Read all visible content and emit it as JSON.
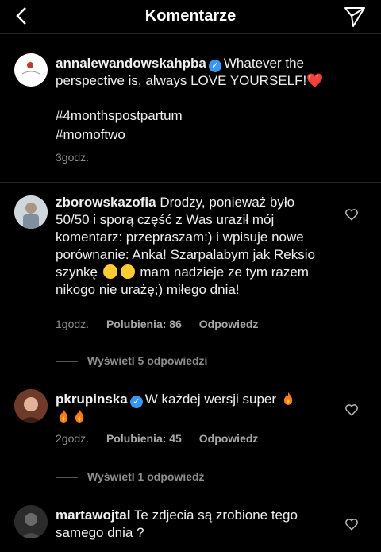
{
  "header": {
    "title": "Komentarze"
  },
  "caption": {
    "username": "annalewandowskahpba",
    "text": "Whatever the perspective is, always LOVE YOURSELF!❤️",
    "tag1": "#4monthspostpartum",
    "tag2": "#momoftwo",
    "time": "3godz."
  },
  "comments": [
    {
      "username": "zborowskazofia",
      "text_a": "Drodzy, ponieważ było 50/50 i sporą część z Was uraził mój komentarz: przepraszam:) i wpisuje nowe porównanie: Anka! Szarpalabym jak Reksio szynkę",
      "text_b": "mam nadzieje ze tym razem nikogo nie urażę;) miłego dnia!",
      "time": "1godz.",
      "likes": "Polubienia: 86",
      "reply": "Odpowiedz",
      "view_replies": "Wyświetl 5 odpowiedzi"
    },
    {
      "username": "pkrupinska",
      "text": "W każdej wersji super",
      "time": "2godz.",
      "likes": "Polubienia: 45",
      "reply": "Odpowiedz",
      "view_replies": "Wyświetl 1 odpowiedź"
    },
    {
      "username": "martawojtal",
      "text": "Te zdjecia są zrobione tego samego dnia ?"
    }
  ],
  "icons": {
    "back": "chevron-left-icon",
    "send": "direct-send-icon",
    "like": "heart-outline-icon",
    "verified": "verified-badge-icon"
  },
  "colors": {
    "background": "#000000",
    "verified": "#3897f0",
    "muted": "#8e8e8e"
  }
}
